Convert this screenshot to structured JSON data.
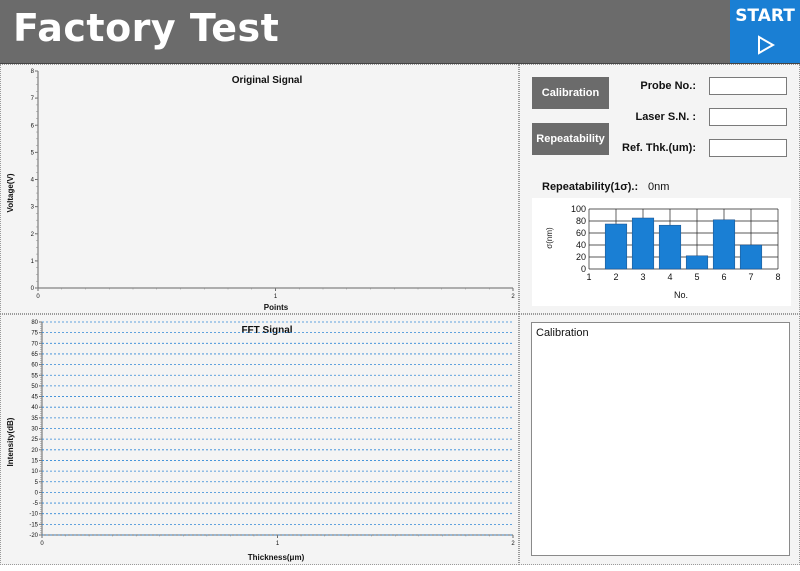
{
  "header": {
    "title": "Factory Test",
    "start_label": "START",
    "start_icon": "play-triangle-icon",
    "background": "#6b6b6b",
    "start_color": "#1a7fd4"
  },
  "original_chart": {
    "chart_data": {
      "type": "line",
      "title": "Original Signal",
      "xlabel": "Points",
      "ylabel": "Voltage(V)",
      "xlim": [
        0,
        2
      ],
      "ylim": [
        0,
        8
      ],
      "xticks": [
        "0",
        "1",
        "2"
      ],
      "yticks": [
        "0",
        "1",
        "2",
        "3",
        "4",
        "5",
        "6",
        "7",
        "8"
      ],
      "series": []
    }
  },
  "fft_chart": {
    "chart_data": {
      "type": "line",
      "title": "FFT Signal",
      "xlabel": "Thickness(μm)",
      "ylabel": "Intensity(dB)",
      "xlim": [
        0,
        2
      ],
      "ylim": [
        -20,
        80
      ],
      "xticks": [
        "0",
        "1",
        "2"
      ],
      "yticks": [
        "-20",
        "-15",
        "-10",
        "-5",
        "0",
        "5",
        "10",
        "15",
        "20",
        "25",
        "30",
        "35",
        "40",
        "45",
        "50",
        "55",
        "60",
        "65",
        "70",
        "75",
        "80"
      ],
      "grid": "horizontal dashed",
      "series": []
    }
  },
  "controls": {
    "calibration_button": "Calibration",
    "repeatability_button": "Repeatability",
    "probe_label": "Probe No.:",
    "probe_value": "",
    "laser_label": "Laser S.N. :",
    "laser_value": "",
    "ref_label": "Ref. Thk.(um):",
    "ref_value": "",
    "repeatability_label": "Repeatability(1σ).:",
    "repeatability_value": "0nm"
  },
  "repeat_chart": {
    "chart_data": {
      "type": "bar",
      "xlabel": "No.",
      "ylabel": "σ(nm)",
      "categories": [
        2,
        3,
        4,
        5,
        6,
        7
      ],
      "values": [
        75,
        85,
        73,
        22,
        82,
        40
      ],
      "xlim": [
        1,
        8
      ],
      "ylim": [
        0,
        100
      ],
      "xticks": [
        "1",
        "2",
        "3",
        "4",
        "5",
        "6",
        "7",
        "8"
      ],
      "yticks": [
        "0",
        "20",
        "40",
        "60",
        "80",
        "100"
      ],
      "bar_color": "#1a7fd4",
      "grid": true
    }
  },
  "log": {
    "text": "Calibration"
  }
}
